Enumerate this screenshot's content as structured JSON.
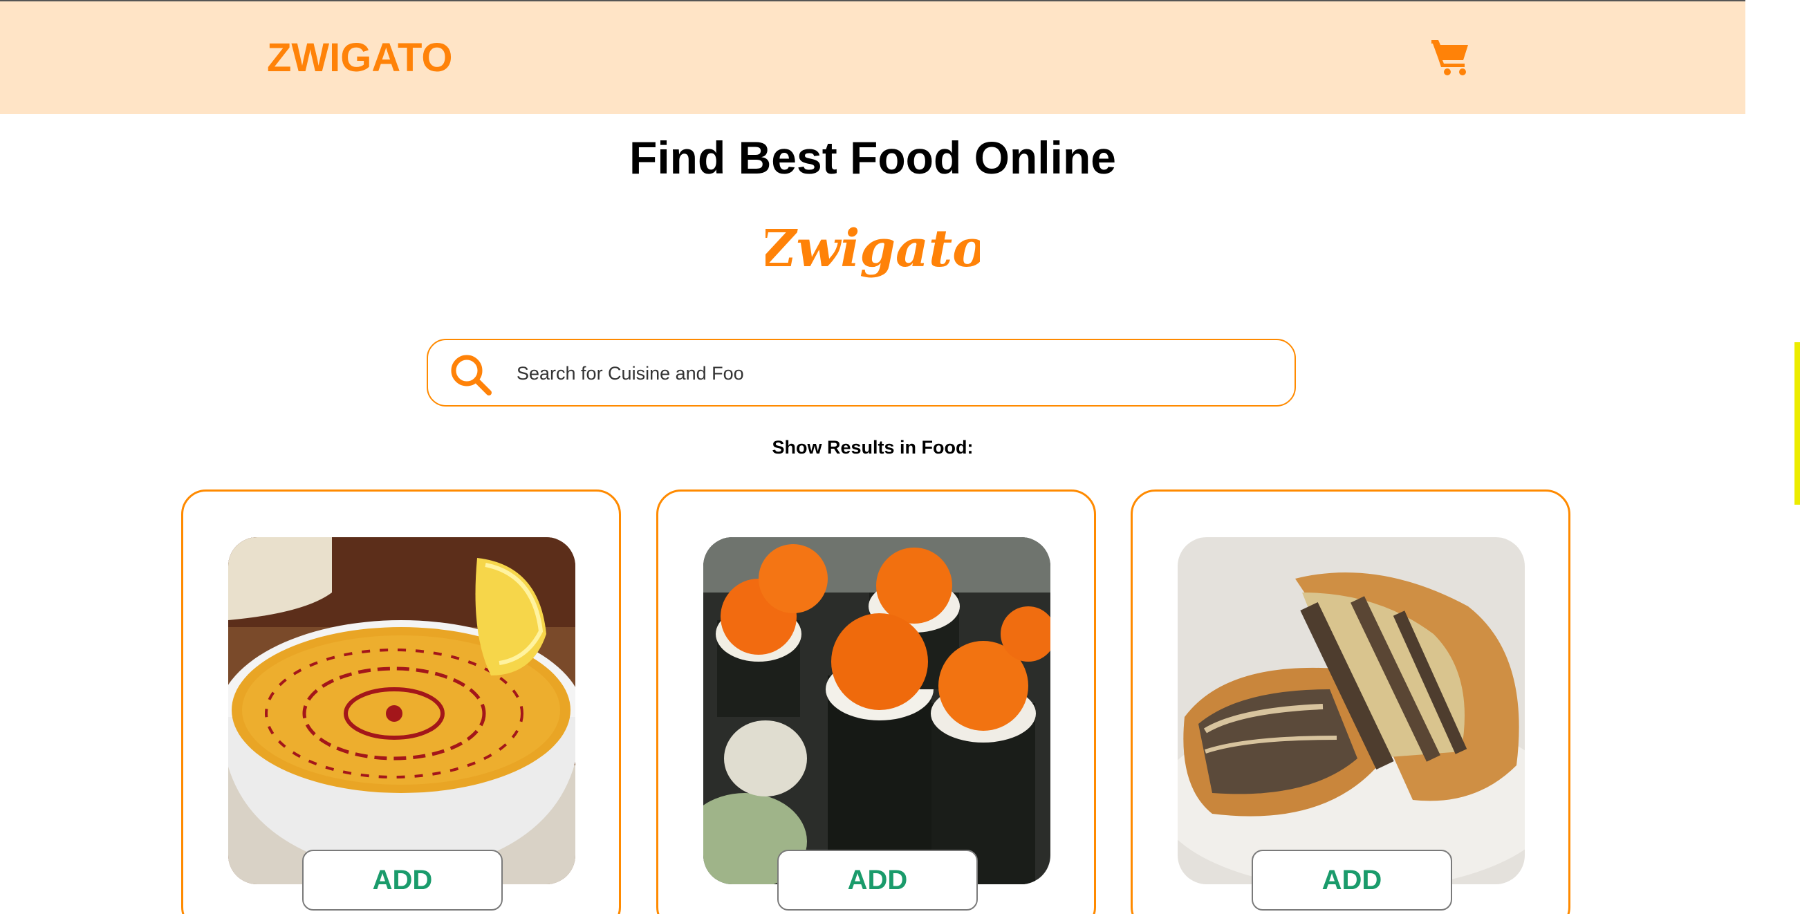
{
  "header": {
    "brand": "ZWIGATO",
    "cart_icon": "cart-icon",
    "background_color": "#ffe4c6",
    "accent_color": "#ff8208"
  },
  "hero": {
    "title": "Find Best Food Online",
    "logo_text": "Zwigato"
  },
  "search": {
    "icon": "search-icon",
    "value": "Search for Cuisine and Foo",
    "placeholder": ""
  },
  "results": {
    "label": "Show Results in Food:"
  },
  "cards": [
    {
      "image": "lentil-soup-image",
      "add_label": "ADD"
    },
    {
      "image": "sushi-roll-image",
      "add_label": "ADD"
    },
    {
      "image": "meat-pie-image",
      "add_label": "ADD"
    }
  ],
  "colors": {
    "border": "#ff8a00",
    "add_text": "#1a9b6b"
  }
}
